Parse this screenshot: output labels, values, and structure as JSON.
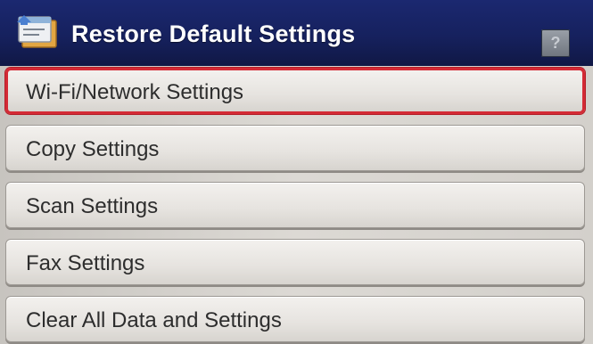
{
  "header": {
    "title": "Restore Default Settings",
    "icon": "settings-restore-icon",
    "help_icon": "help-icon"
  },
  "menu": {
    "selected_index": 0,
    "items": [
      {
        "label": "Wi-Fi/Network Settings"
      },
      {
        "label": "Copy Settings"
      },
      {
        "label": "Scan Settings"
      },
      {
        "label": "Fax Settings"
      },
      {
        "label": "Clear All Data and Settings"
      }
    ]
  },
  "colors": {
    "header_bg": "#1b2870",
    "selected_border": "#d42a35",
    "item_bg": "#e6e3df",
    "text": "#2d2d2d"
  }
}
